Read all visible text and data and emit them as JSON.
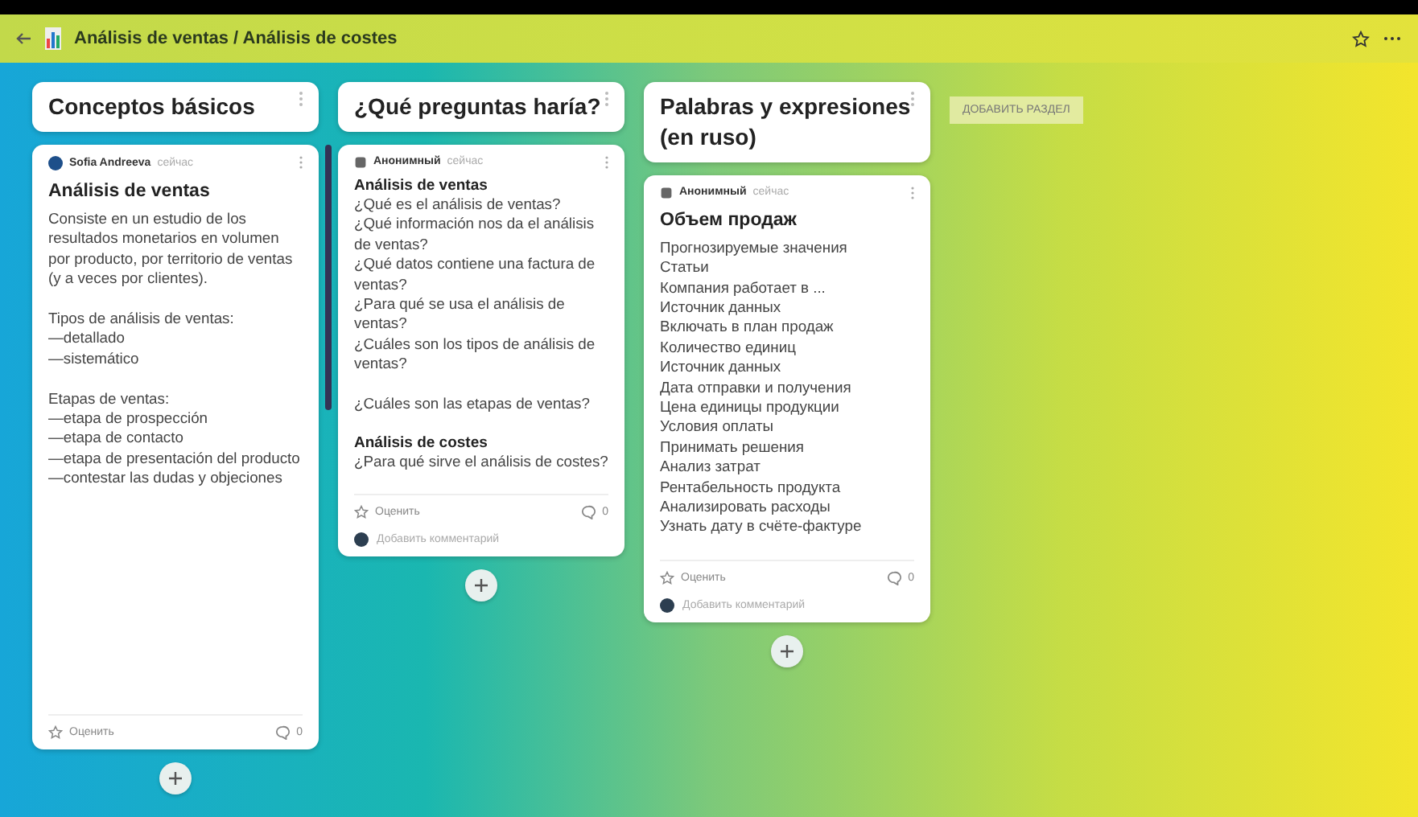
{
  "header": {
    "title": "Análisis de ventas / Análisis de costes"
  },
  "columns": [
    {
      "title": "Conceptos básicos",
      "scrollbar": true,
      "post": {
        "author": "Sofia Andreeva",
        "time": "сейчас",
        "avatar": {
          "kind": "circle"
        },
        "clipped": true,
        "blocks": [
          {
            "kind": "title",
            "text": "Análisis de ventas"
          },
          {
            "kind": "text",
            "text": "Consiste en un estudio de los resultados monetarios en volumen por producto, por territorio de ventas (y a veces por clientes).\n\nTipos de análisis de ventas:\n—detallado\n—sistemático\n\nEtapas de ventas:\n—etapa de prospección\n—etapa de contacto\n—etapa de presentación del producto\n—contestar las dudas y objeciones"
          }
        ],
        "rate": "Оценить",
        "comments": "0"
      }
    },
    {
      "title": "¿Qué preguntas haría?",
      "scrollbar": false,
      "post": {
        "author": "Анонимный",
        "time": "сейчас",
        "avatar": {
          "kind": "square"
        },
        "clipped": false,
        "blocks": [
          {
            "kind": "subtitle",
            "text": "Análisis de ventas"
          },
          {
            "kind": "text",
            "text": "¿Qué es el análisis de ventas?\n¿Qué información nos da el análisis de ventas?\n¿Qué datos contiene una factura de ventas?\n¿Para qué se usa el análisis de ventas?\n¿Cuáles son los tipos de análisis de ventas?\n\n¿Cuáles son las etapas de ventas?\n\n"
          },
          {
            "kind": "subtitle",
            "text": "Análisis de costes"
          },
          {
            "kind": "text",
            "text": "¿Para qué sirve el análisis de costes?"
          }
        ],
        "rate": "Оценить",
        "comments": "0",
        "comment_placeholder": "Добавить комментарий"
      }
    },
    {
      "title": "Palabras y expresiones (en ruso)",
      "scrollbar": false,
      "post": {
        "author": "Анонимный",
        "time": "сейчас",
        "avatar": {
          "kind": "square"
        },
        "clipped": false,
        "blocks": [
          {
            "kind": "title",
            "text": "Объем продаж"
          },
          {
            "kind": "text",
            "text": "Прогнозируемые значения\nСтатьи\nКомпания работает в ...\nИсточник данных\nВключать в план продаж\nКоличество единиц\nИсточник данных\nДата отправки и получения\nЦена единицы продукции\nУсловия оплаты\nПринимать решения\nАнализ затрат\nРентабельность продукта\nАнализировать расходы\nУзнать дату в счёте-фактуре"
          }
        ],
        "rate": "Оценить",
        "comments": "0",
        "comment_placeholder": "Добавить комментарий"
      }
    }
  ],
  "add_section": "ДОБАВИТЬ РАЗДЕЛ"
}
